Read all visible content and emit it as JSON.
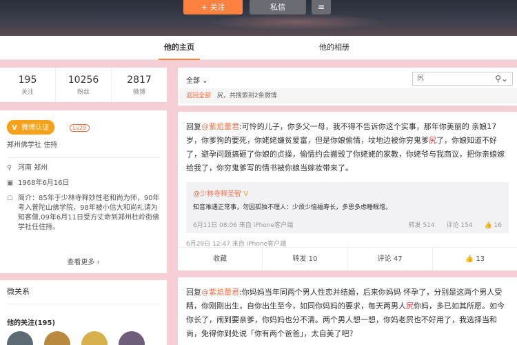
{
  "header": {
    "follow_button": "+ 关注",
    "message_button": "私信",
    "more_button": "≡"
  },
  "tabs": {
    "home": "他的主页",
    "photos": "他的相册"
  },
  "stats": [
    {
      "value": "195",
      "label": "关注"
    },
    {
      "value": "10256",
      "label": "粉丝"
    },
    {
      "value": "2817",
      "label": "微博"
    }
  ],
  "profile": {
    "verified_badge": "微博认证",
    "level_badge": "Lv29",
    "verified_desc": "郑州佛学社 住持",
    "location": "河南 郑州",
    "birthday": "1968年6月16日",
    "bio": "简介：85年于少林寺释妙性老和尚为师，90年考入普陀山佛学院，98年被小信大和尚礼请为知客僧,09年6月11日受方丈命到郑州杜岭街佛学社任住持。",
    "view_more": "查看更多 ›",
    "location_icon": "location-icon",
    "birthday_icon": "birthday-icon",
    "bio_icon": "bio-icon"
  },
  "relations": {
    "title": "微关系",
    "following_title": "他的关注(195)",
    "avatar_colors": [
      "#5c6a74",
      "#b8893f",
      "#d7b24c",
      "#6f5e7a"
    ]
  },
  "search": {
    "filter": "全部 ⌄",
    "query": "尻",
    "back": "返回全部",
    "result_text": "尻，共搜索到2条微博"
  },
  "post1": {
    "reply_prefix": "回复",
    "mention": "@紫焰蕾君",
    "text1": ":可怜的儿子，你多父一母，我不得不告诉你这个实事，那年你美丽的 亲娘17 岁，你爹狗的要死，你姥姥嫌贫爱富，但是你娘偷情，坟地边被你穷鬼爹",
    "highlight": "尻",
    "text2": "了，你娘知道不好了，避孕问题搞砸了你娘的贞操，偷情约会搬毁了你姥姥的家教，你姥爷与我商议，把你亲娘嫁给我了，你穷鬼爹写的情书被你娘当嫁妆带来了。",
    "quote_name": "@少林寺释圣智",
    "quote_text": "知音难遇正常事，勿因孤独不理人：少烦少恼福寿长，多思多虑睡眠增。",
    "quote_time": "6月11日 08:06 来自 iPhone客户端",
    "quote_repost": "转发 514",
    "quote_comment": "评论 154",
    "quote_like": "👍 16",
    "time": "6月29日 12:47 来自 iPhone客户端",
    "collect": "收藏",
    "repost": "转发 10",
    "comment": "评论 47",
    "like": "👍 13"
  },
  "post2": {
    "reply_prefix": "回复",
    "mention": "@紫焰蕾君",
    "text1": ":你妈妈当年同两个男人性恋并结婚，后来你妈妈 怀孕了，分别是这两个男人受精，你刚刚出生，自你出生至今，如同你妈妈的要求，每天两男人",
    "highlight": "尻",
    "text2": "你妈，多已如其所愿。如今你长了，闹到要亲爹，你妈妈也分不清。两个男人想一想，你妈老屄也不好用了，我选择当和尚，免得你到处说「你有两个爸爸」，太自美了吧？"
  }
}
